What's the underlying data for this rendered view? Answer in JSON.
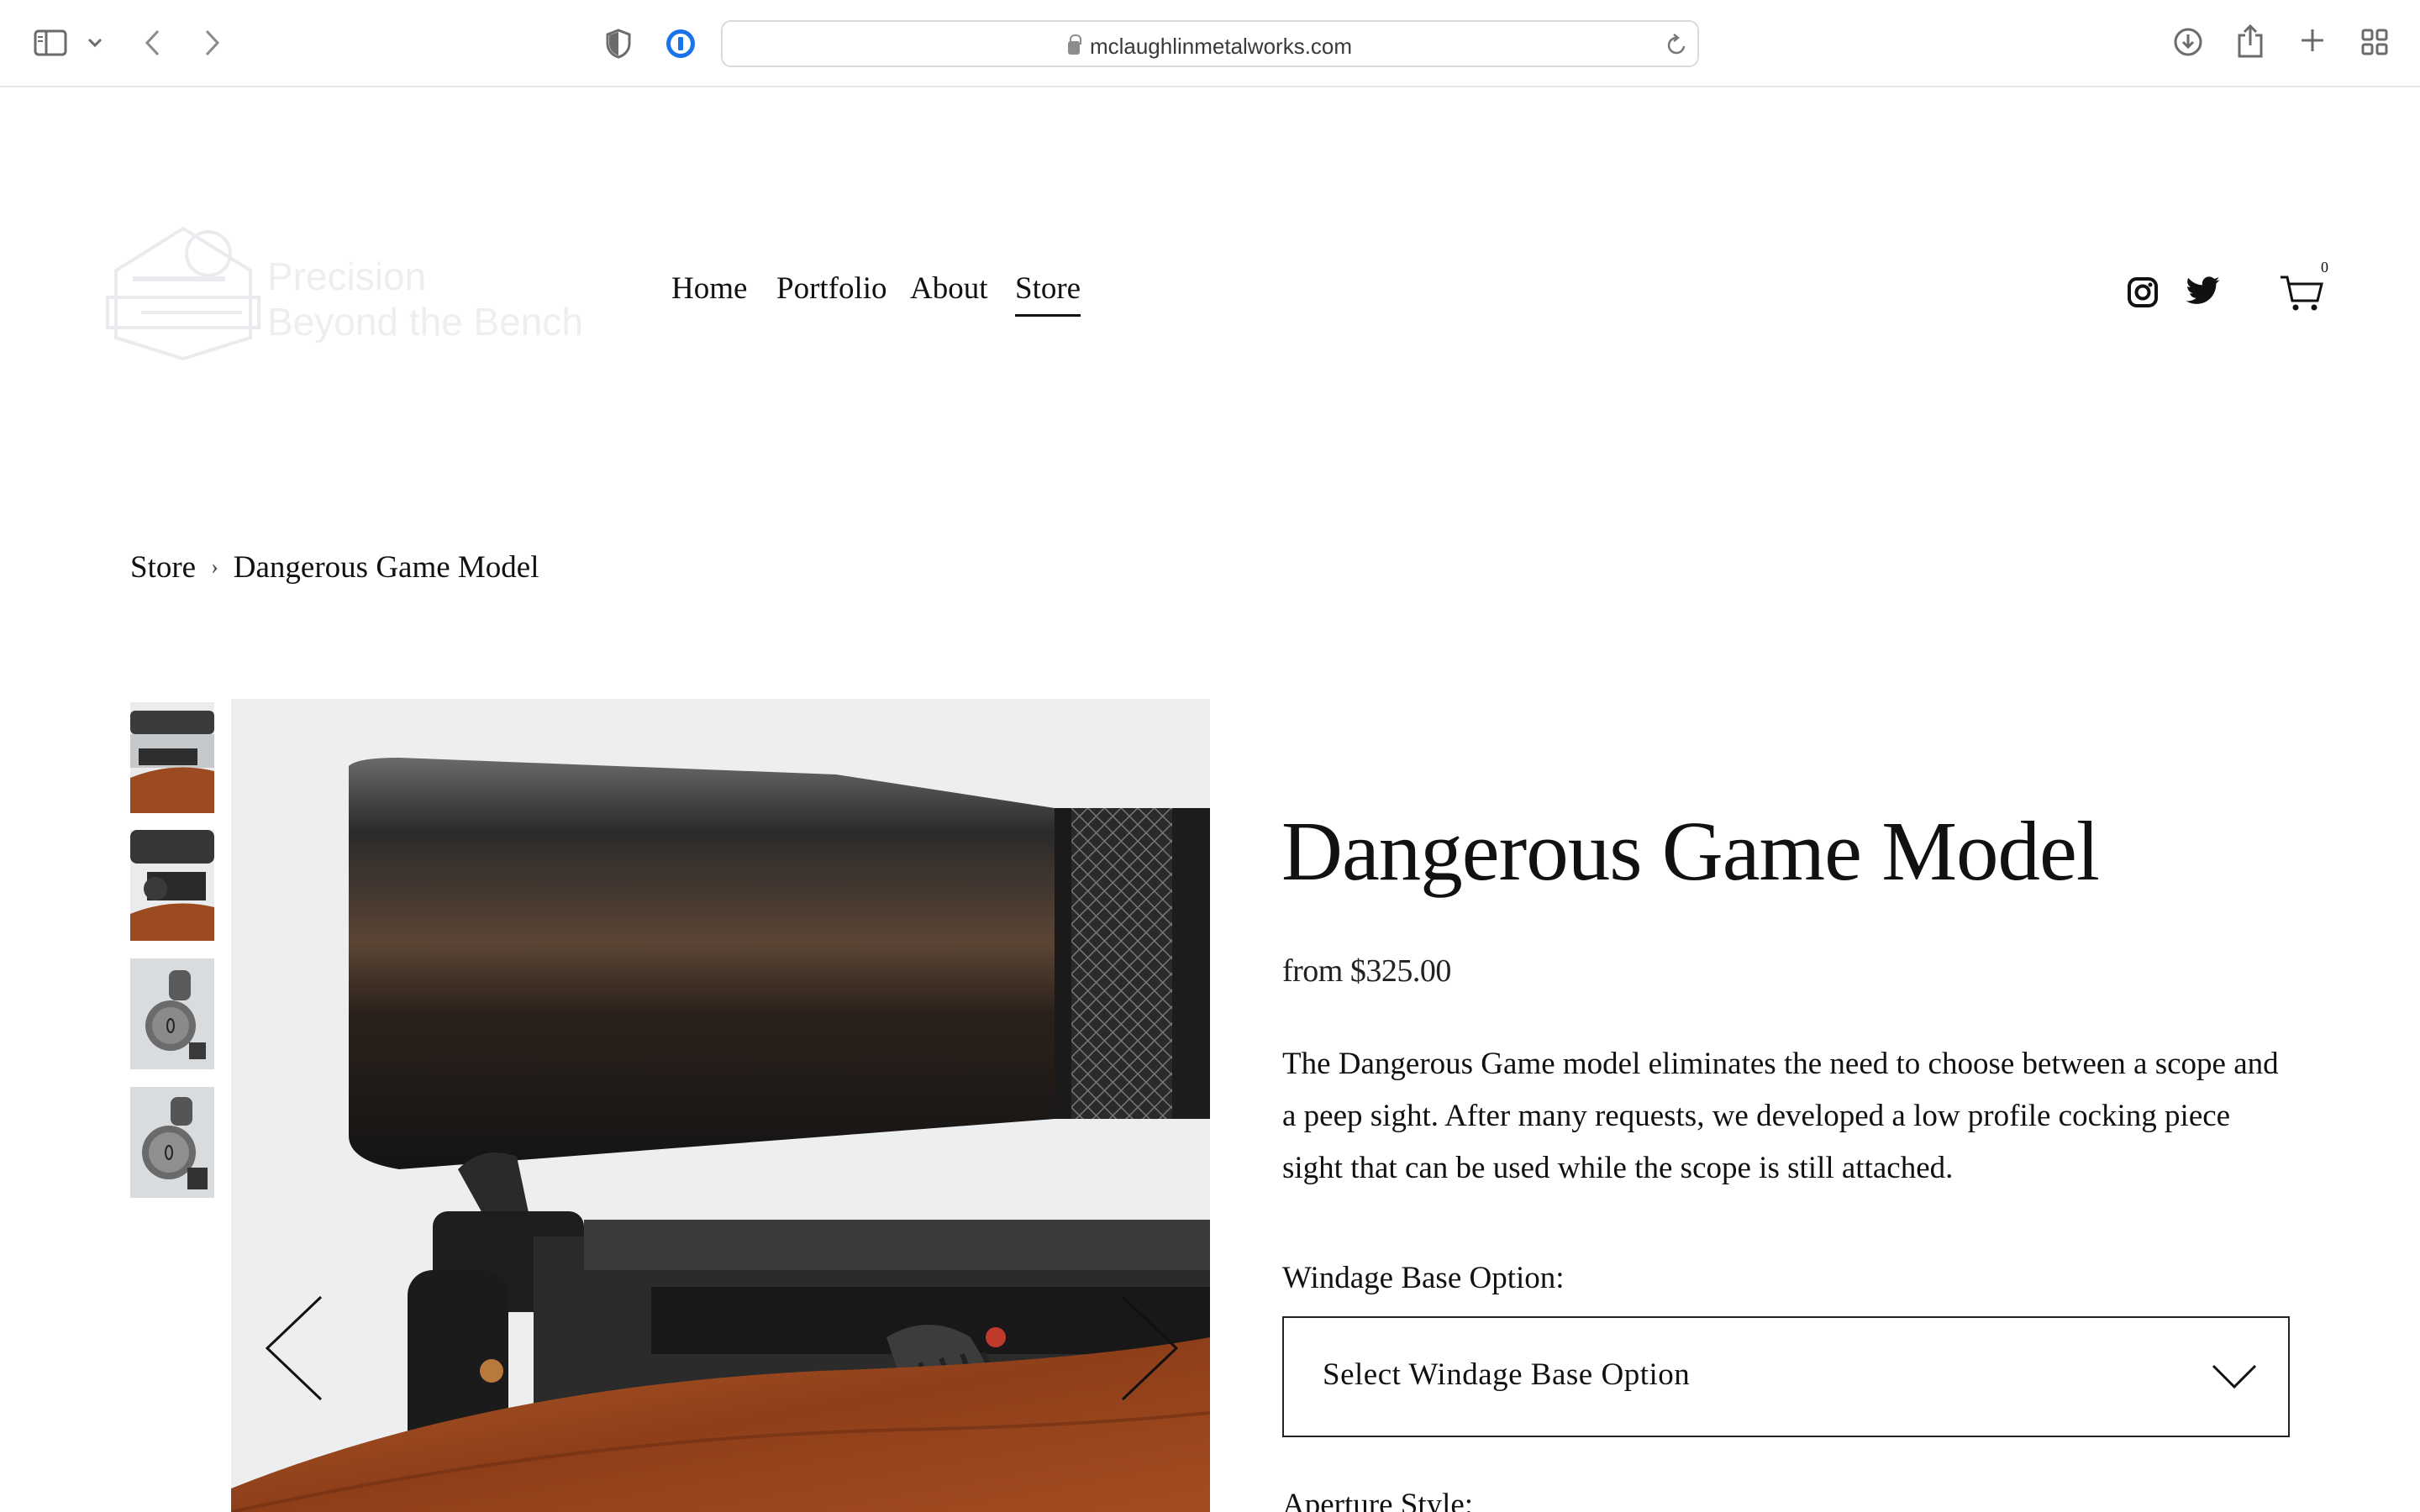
{
  "browser": {
    "url": "mclaughlinmetalworks.com",
    "icons": [
      "sidebar-icon",
      "chevron-down-icon",
      "back-icon",
      "forward-icon",
      "privacy-shield-icon",
      "password-manager-icon",
      "lock-icon",
      "reload-icon",
      "download-icon",
      "share-icon",
      "new-tab-icon",
      "tab-overview-icon"
    ]
  },
  "header": {
    "logo": {
      "line1": "Precision",
      "line2": "Beyond the Bench"
    },
    "nav": [
      {
        "label": "Home"
      },
      {
        "label": "Portfolio"
      },
      {
        "label": "About"
      },
      {
        "label": "Store",
        "active": true
      }
    ],
    "social": [
      "instagram-icon",
      "twitter-icon"
    ],
    "cart_count": "0"
  },
  "breadcrumb": {
    "parent": "Store",
    "separator": "›",
    "current": "Dangerous Game Model"
  },
  "gallery": {
    "thumbnail_count": 4
  },
  "product": {
    "title": "Dangerous Game Model",
    "price": "from $325.00",
    "description": "The Dangerous Game model eliminates the need to choose between a scope and a peep sight. After many requests, we developed a low profile cocking piece sight that can be used while the scope is still attached.",
    "option_label": "Windage Base Option:",
    "select_placeholder": "Select Windage Base Option",
    "next_label_partial": "Aperture Style:"
  },
  "colors": {
    "text": "#111111",
    "chrome_icon": "#6b6b6b",
    "password_manager_blue": "#1a73e8",
    "stock_wood": "#9b4a22"
  }
}
